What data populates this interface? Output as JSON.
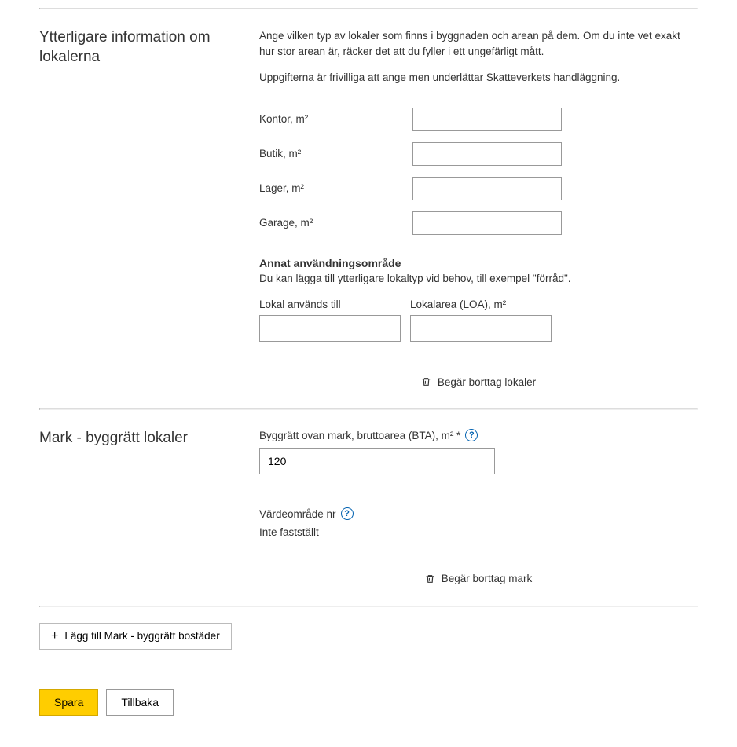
{
  "section1": {
    "heading": "Ytterligare information om lokalerna",
    "intro1": "Ange vilken typ av lokaler som finns i byggnaden och arean på dem. Om du inte vet exakt hur stor arean är, räcker det att du fyller i ett ungefärligt mått.",
    "intro2": "Uppgifterna är frivilliga att ange men underlättar Skatteverkets handläggning.",
    "fields": {
      "kontor": {
        "label": "Kontor, m²",
        "value": ""
      },
      "butik": {
        "label": "Butik, m²",
        "value": ""
      },
      "lager": {
        "label": "Lager, m²",
        "value": ""
      },
      "garage": {
        "label": "Garage, m²",
        "value": ""
      }
    },
    "annat": {
      "heading": "Annat användningsområde",
      "help": "Du kan lägga till ytterligare lokaltyp vid behov, till exempel \"förråd\".",
      "col1_label": "Lokal används till",
      "col1_value": "",
      "col2_label": "Lokalarea (LOA), m²",
      "col2_value": ""
    },
    "remove_label": "Begär borttag lokaler"
  },
  "section2": {
    "heading": "Mark - byggrätt lokaler",
    "byggratt": {
      "label": "Byggrätt ovan mark, bruttoarea (BTA), m² *",
      "value": "120"
    },
    "vardesomrade": {
      "label": "Värdeområde nr",
      "value": "Inte fastställt"
    },
    "remove_label": "Begär borttag mark"
  },
  "add_button_label": "Lägg till Mark - byggrätt bostäder",
  "actions": {
    "save": "Spara",
    "back": "Tillbaka"
  }
}
